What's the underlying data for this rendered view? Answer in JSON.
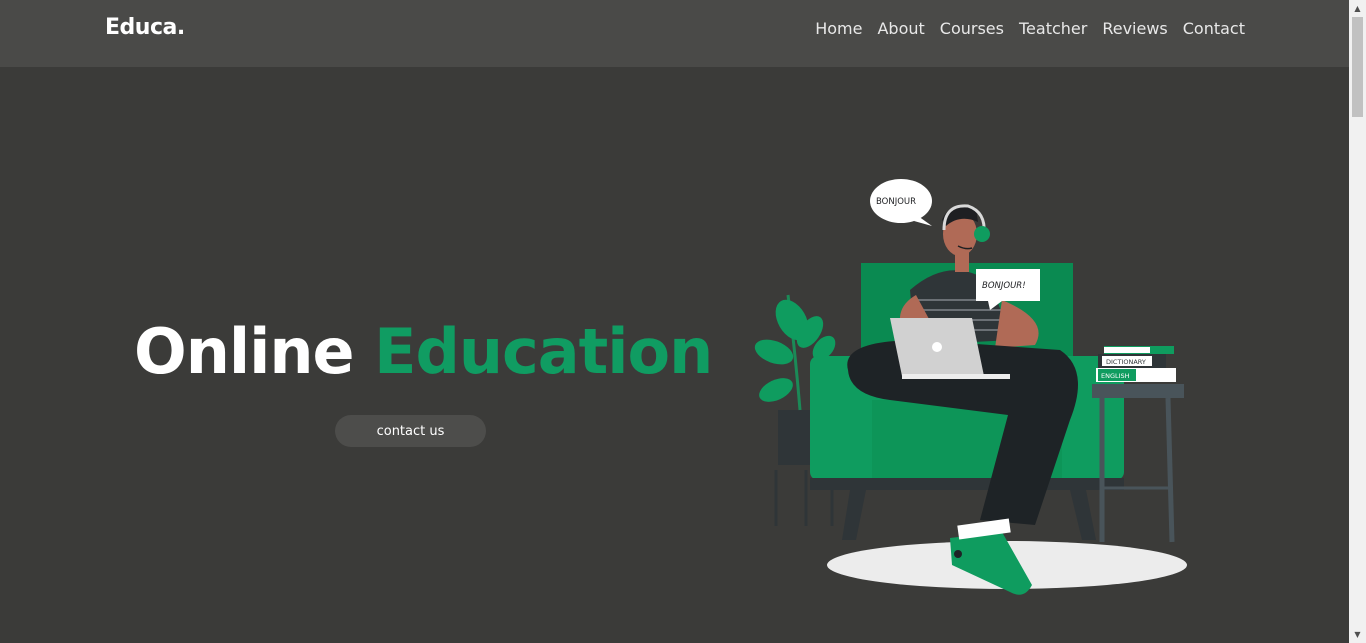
{
  "header": {
    "logo": "Educa.",
    "nav": [
      "Home",
      "About",
      "Courses",
      "Teatcher",
      "Reviews",
      "Contact"
    ]
  },
  "hero": {
    "title_part1": "Online",
    "title_part2": "Education",
    "button": "contact us"
  },
  "illustration": {
    "bubble1": "BONJOUR",
    "bubble2": "BONJOUR!",
    "book1": "DICTIONARY",
    "book2": "ENGLISH"
  },
  "colors": {
    "accent": "#109c62",
    "background": "#3b3b39",
    "navbar": "#4a4a48"
  }
}
